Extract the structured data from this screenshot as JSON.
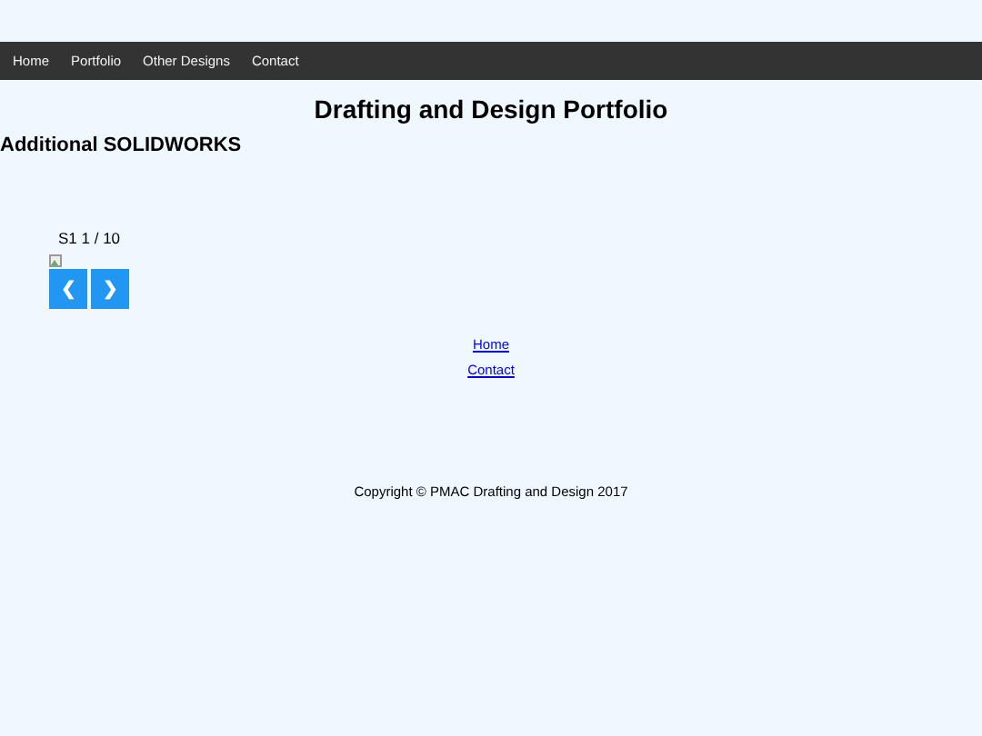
{
  "nav": {
    "items": [
      {
        "label": "Home"
      },
      {
        "label": "Portfolio"
      },
      {
        "label": "Other Designs"
      },
      {
        "label": "Contact"
      }
    ]
  },
  "title": "Drafting and Design Portfolio",
  "subtitle": "Additional SOLIDWORKS",
  "slideshow": {
    "counter": "S1 1 / 10",
    "prev": "❮",
    "next": "❯"
  },
  "links": [
    "Home",
    "Contact"
  ],
  "footer": "Copyright © PMAC Drafting and Design 2017"
}
